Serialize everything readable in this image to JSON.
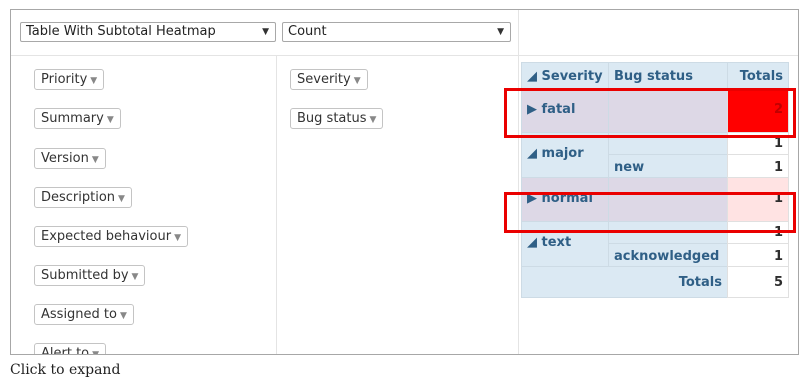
{
  "controls": {
    "renderer": "Table With Subtotal Heatmap",
    "aggregator": "Count"
  },
  "unused_attributes": [
    {
      "label": "Priority"
    },
    {
      "label": "Summary"
    },
    {
      "label": "Version"
    },
    {
      "label": "Description"
    },
    {
      "label": "Expected behaviour"
    },
    {
      "label": "Submitted by"
    },
    {
      "label": "Assigned to"
    },
    {
      "label": "Alert to"
    }
  ],
  "row_attributes": [
    {
      "label": "Severity"
    },
    {
      "label": "Bug status"
    }
  ],
  "table": {
    "headers": {
      "severity": "◢ Severity",
      "bug_status": "Bug status",
      "totals": "Totals"
    },
    "rows": {
      "fatal": {
        "label": "▶ fatal",
        "value": "2"
      },
      "major": {
        "label": "◢ major",
        "total": "1",
        "sub_label": "new",
        "sub_value": "1"
      },
      "normal": {
        "label": "▶ normal",
        "value": "1"
      },
      "text": {
        "label": "◢ text",
        "total": "1",
        "sub_label": "acknowledged",
        "sub_value": "1"
      }
    },
    "grand_total_label": "Totals",
    "grand_total_value": "5"
  },
  "heatmap_colors": {
    "high": "#ff0000",
    "low": "#ffe3e3"
  },
  "highlight_color": "#ea0000",
  "caption": "Click to expand"
}
